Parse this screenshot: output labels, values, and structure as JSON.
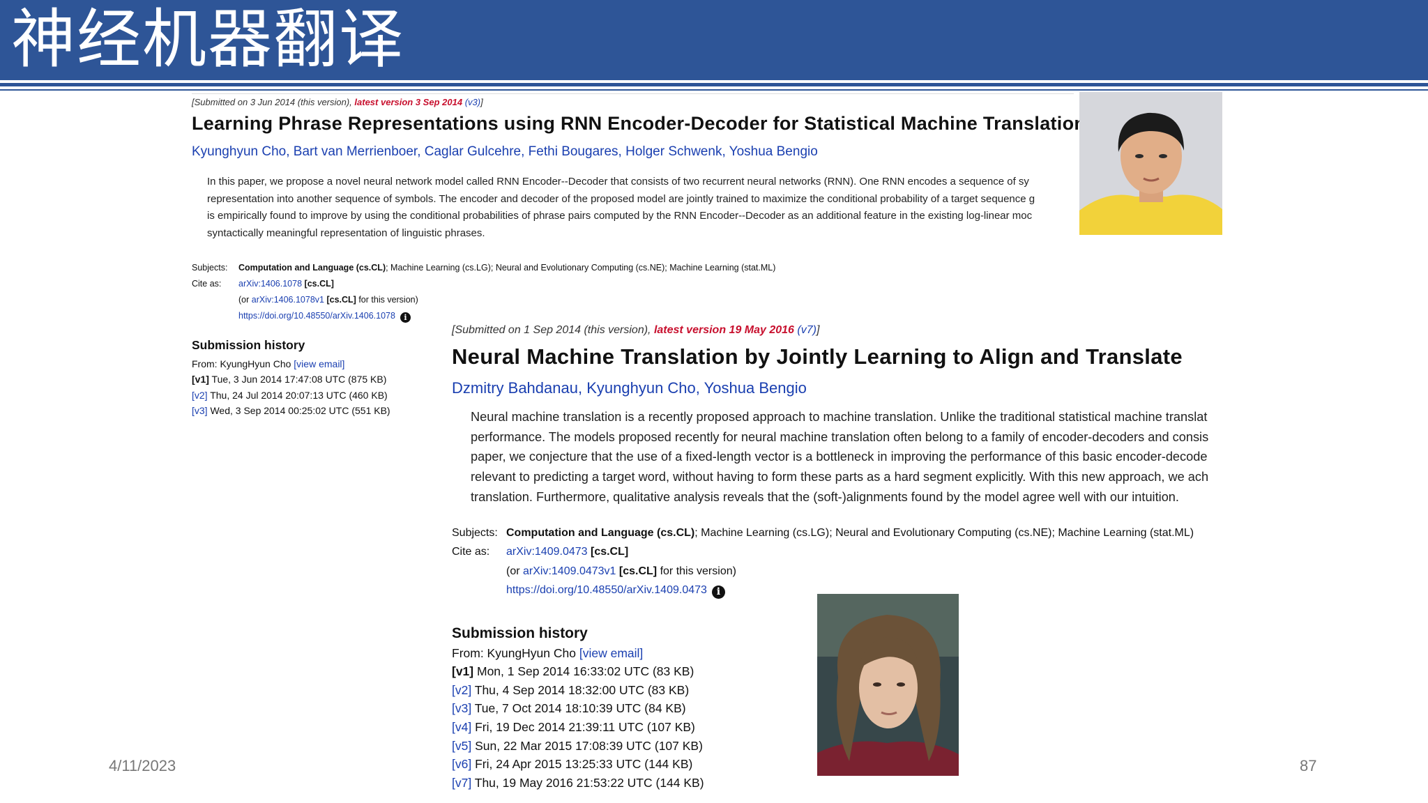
{
  "slide": {
    "title": "神经机器翻译",
    "date": "4/11/2023",
    "page_number": "87"
  },
  "paper1": {
    "submitted_prefix": "[Submitted on 3 Jun 2014 (this version), ",
    "latest_label": "latest version 3 Sep 2014",
    "version_link": "(v3)",
    "submitted_suffix": "]",
    "title": "Learning Phrase Representations using RNN Encoder-Decoder for Statistical Machine Translation",
    "authors": [
      "Kyunghyun Cho",
      "Bart van Merrienboer",
      "Caglar Gulcehre",
      "Fethi Bougares",
      "Holger Schwenk",
      "Yoshua Bengio"
    ],
    "abstract_lines": [
      "In this paper, we propose a novel neural network model called RNN Encoder--Decoder that consists of two recurrent neural networks (RNN). One RNN encodes a sequence of sy",
      "representation into another sequence of symbols. The encoder and decoder of the proposed model are jointly trained to maximize the conditional probability of a target sequence g",
      "is empirically found to improve by using the conditional probabilities of phrase pairs computed by the RNN Encoder--Decoder as an additional feature in the existing log-linear moc",
      "syntactically meaningful representation of linguistic phrases."
    ],
    "subjects_label": "Subjects:",
    "subjects_primary": "Computation and Language (cs.CL)",
    "subjects_rest": "; Machine Learning (cs.LG); Neural and Evolutionary Computing (cs.NE); Machine Learning (stat.ML)",
    "cite_label": "Cite as:",
    "cite_id": "arXiv:1406.1078",
    "cite_cat": "[cs.CL]",
    "cite_alt_prefix": "(or ",
    "cite_alt_id": "arXiv:1406.1078v1",
    "cite_alt_cat": "[cs.CL]",
    "cite_alt_suffix": " for this version)",
    "doi": "https://doi.org/10.48550/arXiv.1406.1078",
    "history_title": "Submission history",
    "history_from": "From: KyungHyun Cho ",
    "view_email": "[view email]",
    "history": [
      {
        "v": "[v1]",
        "text": " Tue, 3 Jun 2014 17:47:08 UTC (875 KB)"
      },
      {
        "v": "[v2]",
        "text": " Thu, 24 Jul 2014 20:07:13 UTC (460 KB)"
      },
      {
        "v": "[v3]",
        "text": " Wed, 3 Sep 2014 00:25:02 UTC (551 KB)"
      }
    ]
  },
  "paper2": {
    "submitted_prefix": "[Submitted on 1 Sep 2014 (this version), ",
    "latest_label": "latest version 19 May 2016",
    "version_link": "(v7)",
    "submitted_suffix": "]",
    "title": "Neural Machine Translation by Jointly Learning to Align and Translate",
    "authors": [
      "Dzmitry Bahdanau",
      "Kyunghyun Cho",
      "Yoshua Bengio"
    ],
    "abstract_lines": [
      "Neural machine translation is a recently proposed approach to machine translation. Unlike the traditional statistical machine translat",
      "performance. The models proposed recently for neural machine translation often belong to a family of encoder-decoders and consis",
      "paper, we conjecture that the use of a fixed-length vector is a bottleneck in improving the performance of this basic encoder-decode",
      "relevant to predicting a target word, without having to form these parts as a hard segment explicitly. With this new approach, we ach",
      "translation. Furthermore, qualitative analysis reveals that the (soft-)alignments found by the model agree well with our intuition."
    ],
    "subjects_label": "Subjects:",
    "subjects_primary": "Computation and Language (cs.CL)",
    "subjects_rest": "; Machine Learning (cs.LG); Neural and Evolutionary Computing (cs.NE); Machine Learning (stat.ML)",
    "cite_label": "Cite as:",
    "cite_id": "arXiv:1409.0473",
    "cite_cat": "[cs.CL]",
    "cite_alt_prefix": "(or ",
    "cite_alt_id": "arXiv:1409.0473v1",
    "cite_alt_cat": "[cs.CL]",
    "cite_alt_suffix": " for this version)",
    "doi": "https://doi.org/10.48550/arXiv.1409.0473",
    "history_title": "Submission history",
    "history_from": "From: KyungHyun Cho ",
    "view_email": "[view email]",
    "history": [
      {
        "v": "[v1]",
        "text": " Mon, 1 Sep 2014 16:33:02 UTC (83 KB)"
      },
      {
        "v": "[v2]",
        "text": " Thu, 4 Sep 2014 18:32:00 UTC (83 KB)"
      },
      {
        "v": "[v3]",
        "text": " Tue, 7 Oct 2014 18:10:39 UTC (84 KB)"
      },
      {
        "v": "[v4]",
        "text": " Fri, 19 Dec 2014 21:39:11 UTC (107 KB)"
      },
      {
        "v": "[v5]",
        "text": " Sun, 22 Mar 2015 17:08:39 UTC (107 KB)"
      },
      {
        "v": "[v6]",
        "text": " Fri, 24 Apr 2015 13:25:33 UTC (144 KB)"
      },
      {
        "v": "[v7]",
        "text": " Thu, 19 May 2016 21:53:22 UTC (144 KB)"
      }
    ]
  },
  "icons": {
    "info": "info-icon"
  },
  "colors": {
    "banner": "#2e5597",
    "link": "#1a3fb0",
    "latest": "#c8102e"
  }
}
